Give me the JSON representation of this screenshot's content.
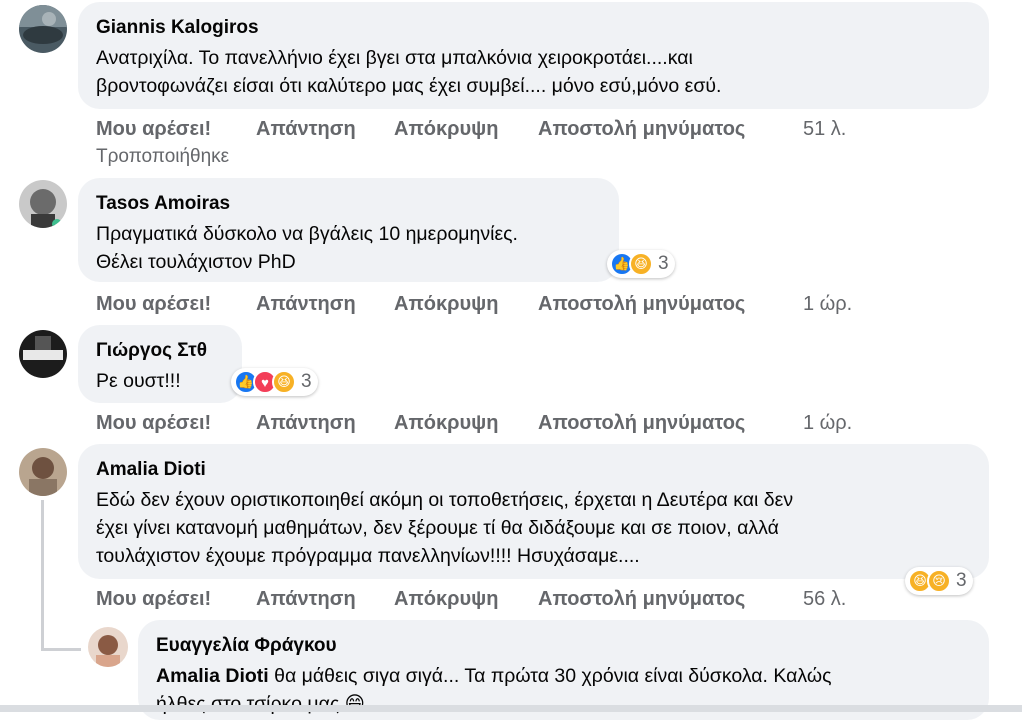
{
  "actions": {
    "like": "Μου αρέσει!",
    "reply": "Απάντηση",
    "hide": "Απόκρυψη",
    "message": "Αποστολή μηνύματος"
  },
  "comments": [
    {
      "author": "Giannis Kalogiros",
      "lines": [
        "Ανατριχίλα. Το πανελλήνιο έχει βγει στα μπαλκόνια χειροκροτάει....και",
        "βροντοφωνάζει είσαι ότι καλύτερο μας έχει συμβεί.... μόνο εσύ,μόνο εσύ."
      ],
      "time": "51 λ.",
      "edited": "Τροποποιήθηκε"
    },
    {
      "author": "Tasos Amoiras",
      "lines": [
        "Πραγματικά δύσκολο να βγάλεις 10 ημερομηνίες.",
        "Θέλει τουλάχιστον PhD"
      ],
      "time": "1 ώρ.",
      "reaction_count": "3",
      "reactions": [
        "like-icon",
        "haha-icon"
      ]
    },
    {
      "author": "Γιώργος Στθ",
      "lines": [
        "Ρε ουστ!!!"
      ],
      "time": "1 ώρ.",
      "reaction_count": "3",
      "reactions": [
        "like-icon",
        "love-icon",
        "haha-icon"
      ]
    },
    {
      "author": "Amalia Dioti",
      "lines": [
        "Εδώ δεν έχουν οριστικοποιηθεί ακόμη οι τοποθετήσεις, έρχεται η Δευτέρα και δεν",
        "έχει γίνει κατανομή μαθημάτων, δεν ξέρουμε τί θα διδάξουμε και σε ποιον, αλλά",
        "τουλάχιστον έχουμε πρόγραμμα πανελληνίων!!!! Ησυχάσαμε...."
      ],
      "time": "56 λ.",
      "reaction_count": "3",
      "reactions": [
        "haha-icon",
        "sad-icon"
      ]
    }
  ],
  "reply": {
    "author": "Ευαγγελία Φράγκου",
    "mention": "Amalia Dioti",
    "line1": " θα μάθεις σιγα σιγά... Τα πρώτα 30 χρόνια είναι δύσκολα. Καλώς",
    "line2": "ήλθες στο τσίρκο μας 😄"
  }
}
